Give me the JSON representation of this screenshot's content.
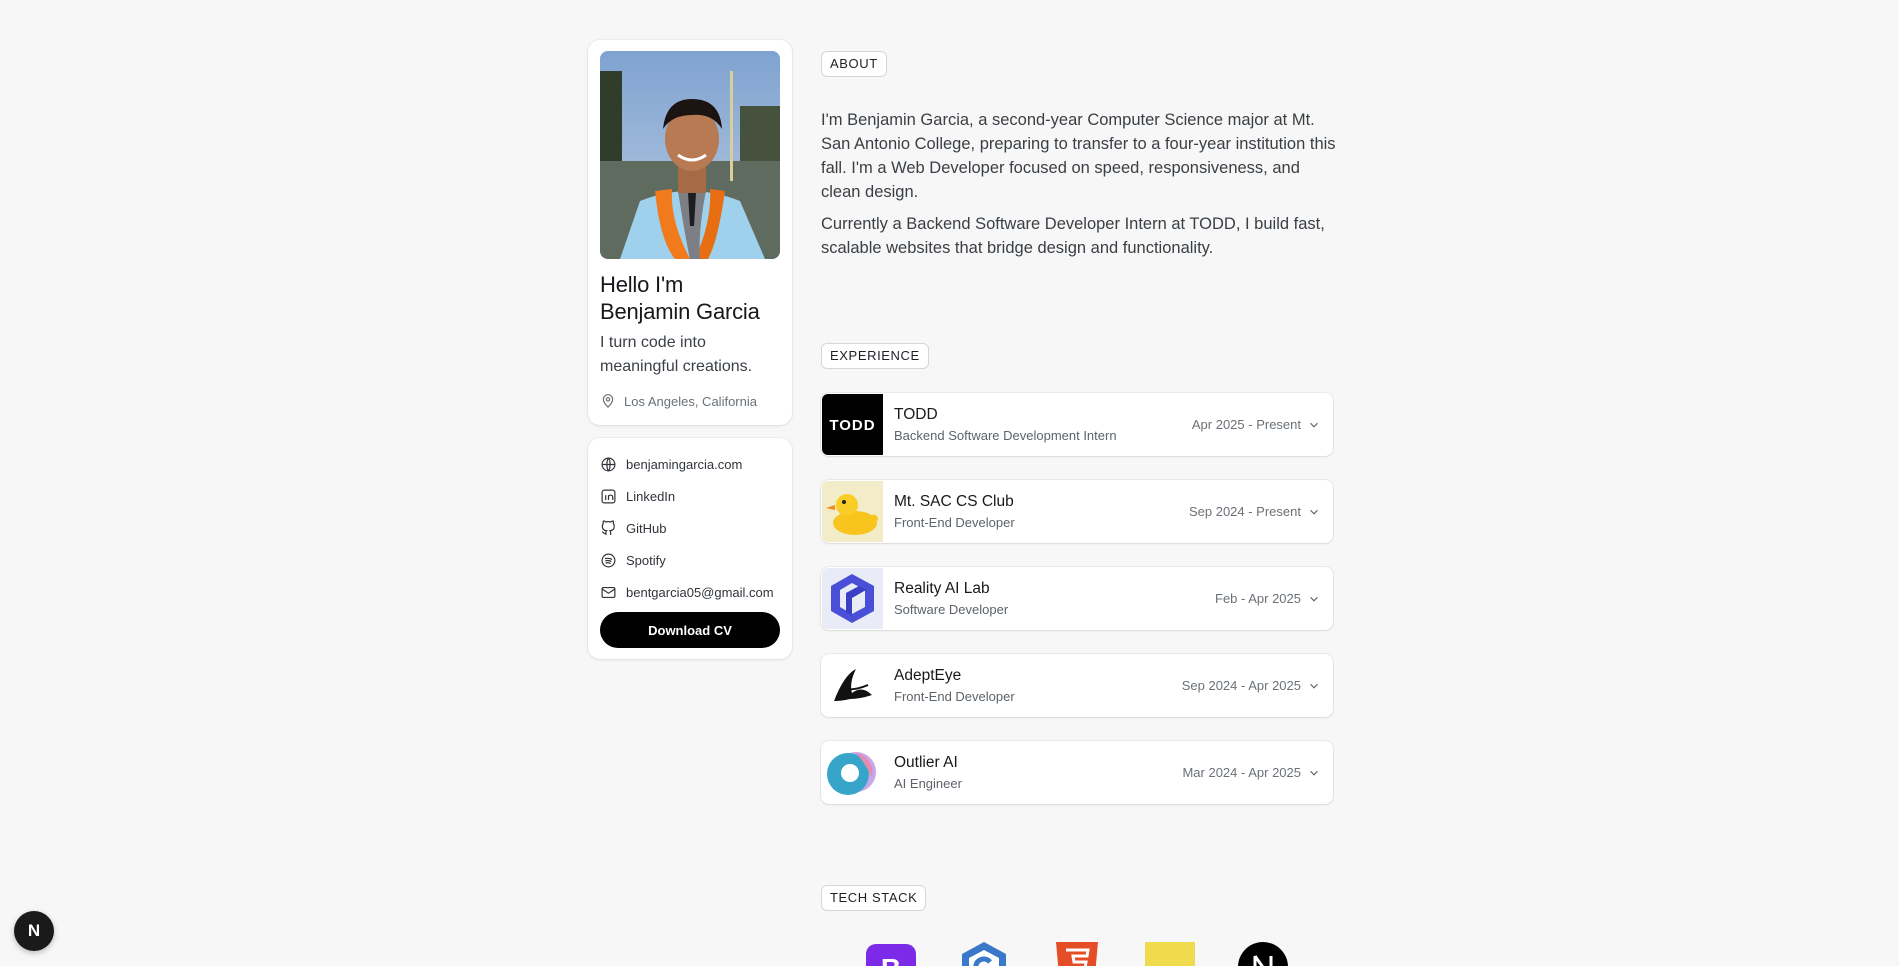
{
  "profile": {
    "hello_line1": "Hello I'm",
    "hello_line2": "Benjamin Garcia",
    "tagline": "I turn code into meaningful creations.",
    "location": "Los Angeles, California"
  },
  "links": {
    "items": [
      {
        "label": "benjamingarcia.com",
        "icon": "globe-icon"
      },
      {
        "label": "LinkedIn",
        "icon": "linkedin-icon"
      },
      {
        "label": "GitHub",
        "icon": "github-icon"
      },
      {
        "label": "Spotify",
        "icon": "spotify-icon"
      },
      {
        "label": "bentgarcia05@gmail.com",
        "icon": "mail-icon"
      }
    ],
    "download_label": "Download CV"
  },
  "about": {
    "tag": "ABOUT",
    "paragraph1": "I'm Benjamin Garcia, a second-year Computer Science major at Mt. San Antonio College, preparing to transfer to a four-year institution this fall. I'm a Web Developer focused on speed, responsiveness, and clean design.",
    "paragraph2": "Currently a Backend Software Developer Intern at TODD, I build fast, scalable websites that bridge design and functionality."
  },
  "experience": {
    "tag": "EXPERIENCE",
    "items": [
      {
        "company": "TODD",
        "role": "Backend Software Development Intern",
        "dates": "Apr 2025 - Present",
        "logo_text": "TODD"
      },
      {
        "company": "Mt. SAC CS Club",
        "role": "Front-End Developer",
        "dates": "Sep 2024 - Present"
      },
      {
        "company": "Reality AI Lab",
        "role": "Software Developer",
        "dates": "Feb - Apr 2025"
      },
      {
        "company": "AdeptEye",
        "role": "Front-End Developer",
        "dates": "Sep 2024 - Apr 2025"
      },
      {
        "company": "Outlier AI",
        "role": "AI Engineer",
        "dates": "Mar 2024 - Apr 2025"
      }
    ]
  },
  "tech_stack": {
    "tag": "TECH STACK"
  },
  "dev_badge": {
    "letter": "N"
  },
  "colors": {
    "background": "#f6f7f6",
    "button": "#000000",
    "card": "#ffffff"
  }
}
